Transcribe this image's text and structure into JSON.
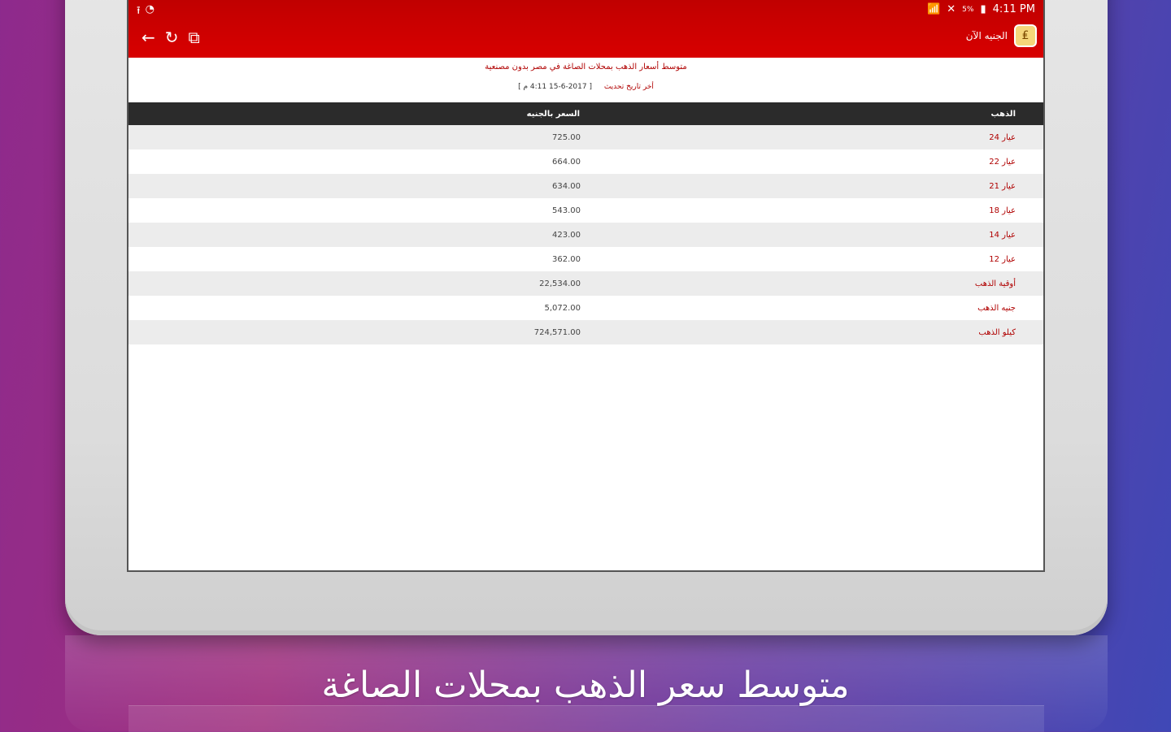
{
  "statusbar": {
    "left_icons": [
      "⭱",
      "◔"
    ],
    "wifi": "📶",
    "signal": "✕",
    "network": "5%",
    "battery": "▮",
    "time": "4:11 PM"
  },
  "toolbar": {
    "back": "←",
    "refresh": "↻",
    "share": "⧉",
    "app_title": "الجنيه الآن",
    "app_icon": "₤"
  },
  "content": {
    "heading": "متوسط أسعار الذهب بمحلات الصاغة في مصر بدون مصنعية",
    "date_label": "أخر تاريخ تحديث",
    "date_value": "[ 2017-6-15 4:11 م ]"
  },
  "table": {
    "headers": {
      "type": "الذهب",
      "price": "السعر بالجنيه"
    },
    "rows": [
      {
        "type": "عيار 24",
        "price": "725.00"
      },
      {
        "type": "عيار 22",
        "price": "664.00"
      },
      {
        "type": "عيار 21",
        "price": "634.00"
      },
      {
        "type": "عيار 18",
        "price": "543.00"
      },
      {
        "type": "عيار 14",
        "price": "423.00"
      },
      {
        "type": "عيار 12",
        "price": "362.00"
      },
      {
        "type": "أوقية الذهب",
        "price": "22,534.00"
      },
      {
        "type": "جنيه الذهب",
        "price": "5,072.00"
      },
      {
        "type": "كيلو الذهب",
        "price": "724,571.00"
      }
    ]
  },
  "caption": "متوسط سعر الذهب بمحلات الصاغة"
}
